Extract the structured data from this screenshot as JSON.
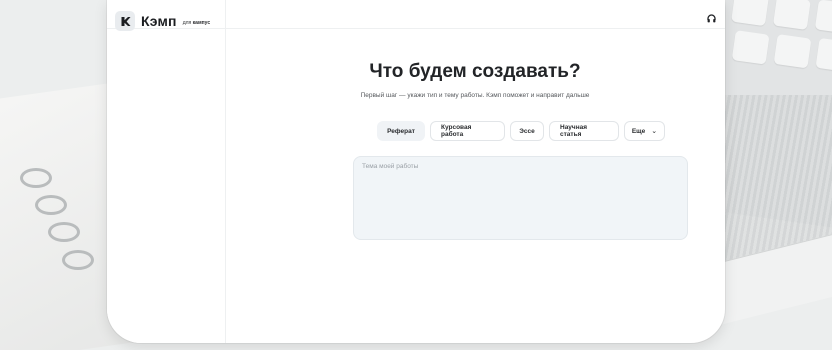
{
  "app": {
    "logo_title": "Кэмп",
    "logo_subtitle_prefix": "для",
    "logo_subtitle_brand": "кампус"
  },
  "main": {
    "title": "Что будем создавать?",
    "subtitle": "Первый шаг — укажи тип и тему работы. Кэмп поможет и направит дальше",
    "work_types": [
      {
        "label": "Реферат",
        "selected": true
      },
      {
        "label": "Курсовая работа",
        "selected": false
      },
      {
        "label": "Эссе",
        "selected": false
      },
      {
        "label": "Научная статья",
        "selected": false
      }
    ],
    "more_label": "Еще",
    "topic": {
      "placeholder": "Тема моей работы",
      "value": ""
    }
  },
  "icons": {
    "logo": "k-logo-icon",
    "help": "headphones-icon",
    "more": "chevron-down-icon"
  }
}
